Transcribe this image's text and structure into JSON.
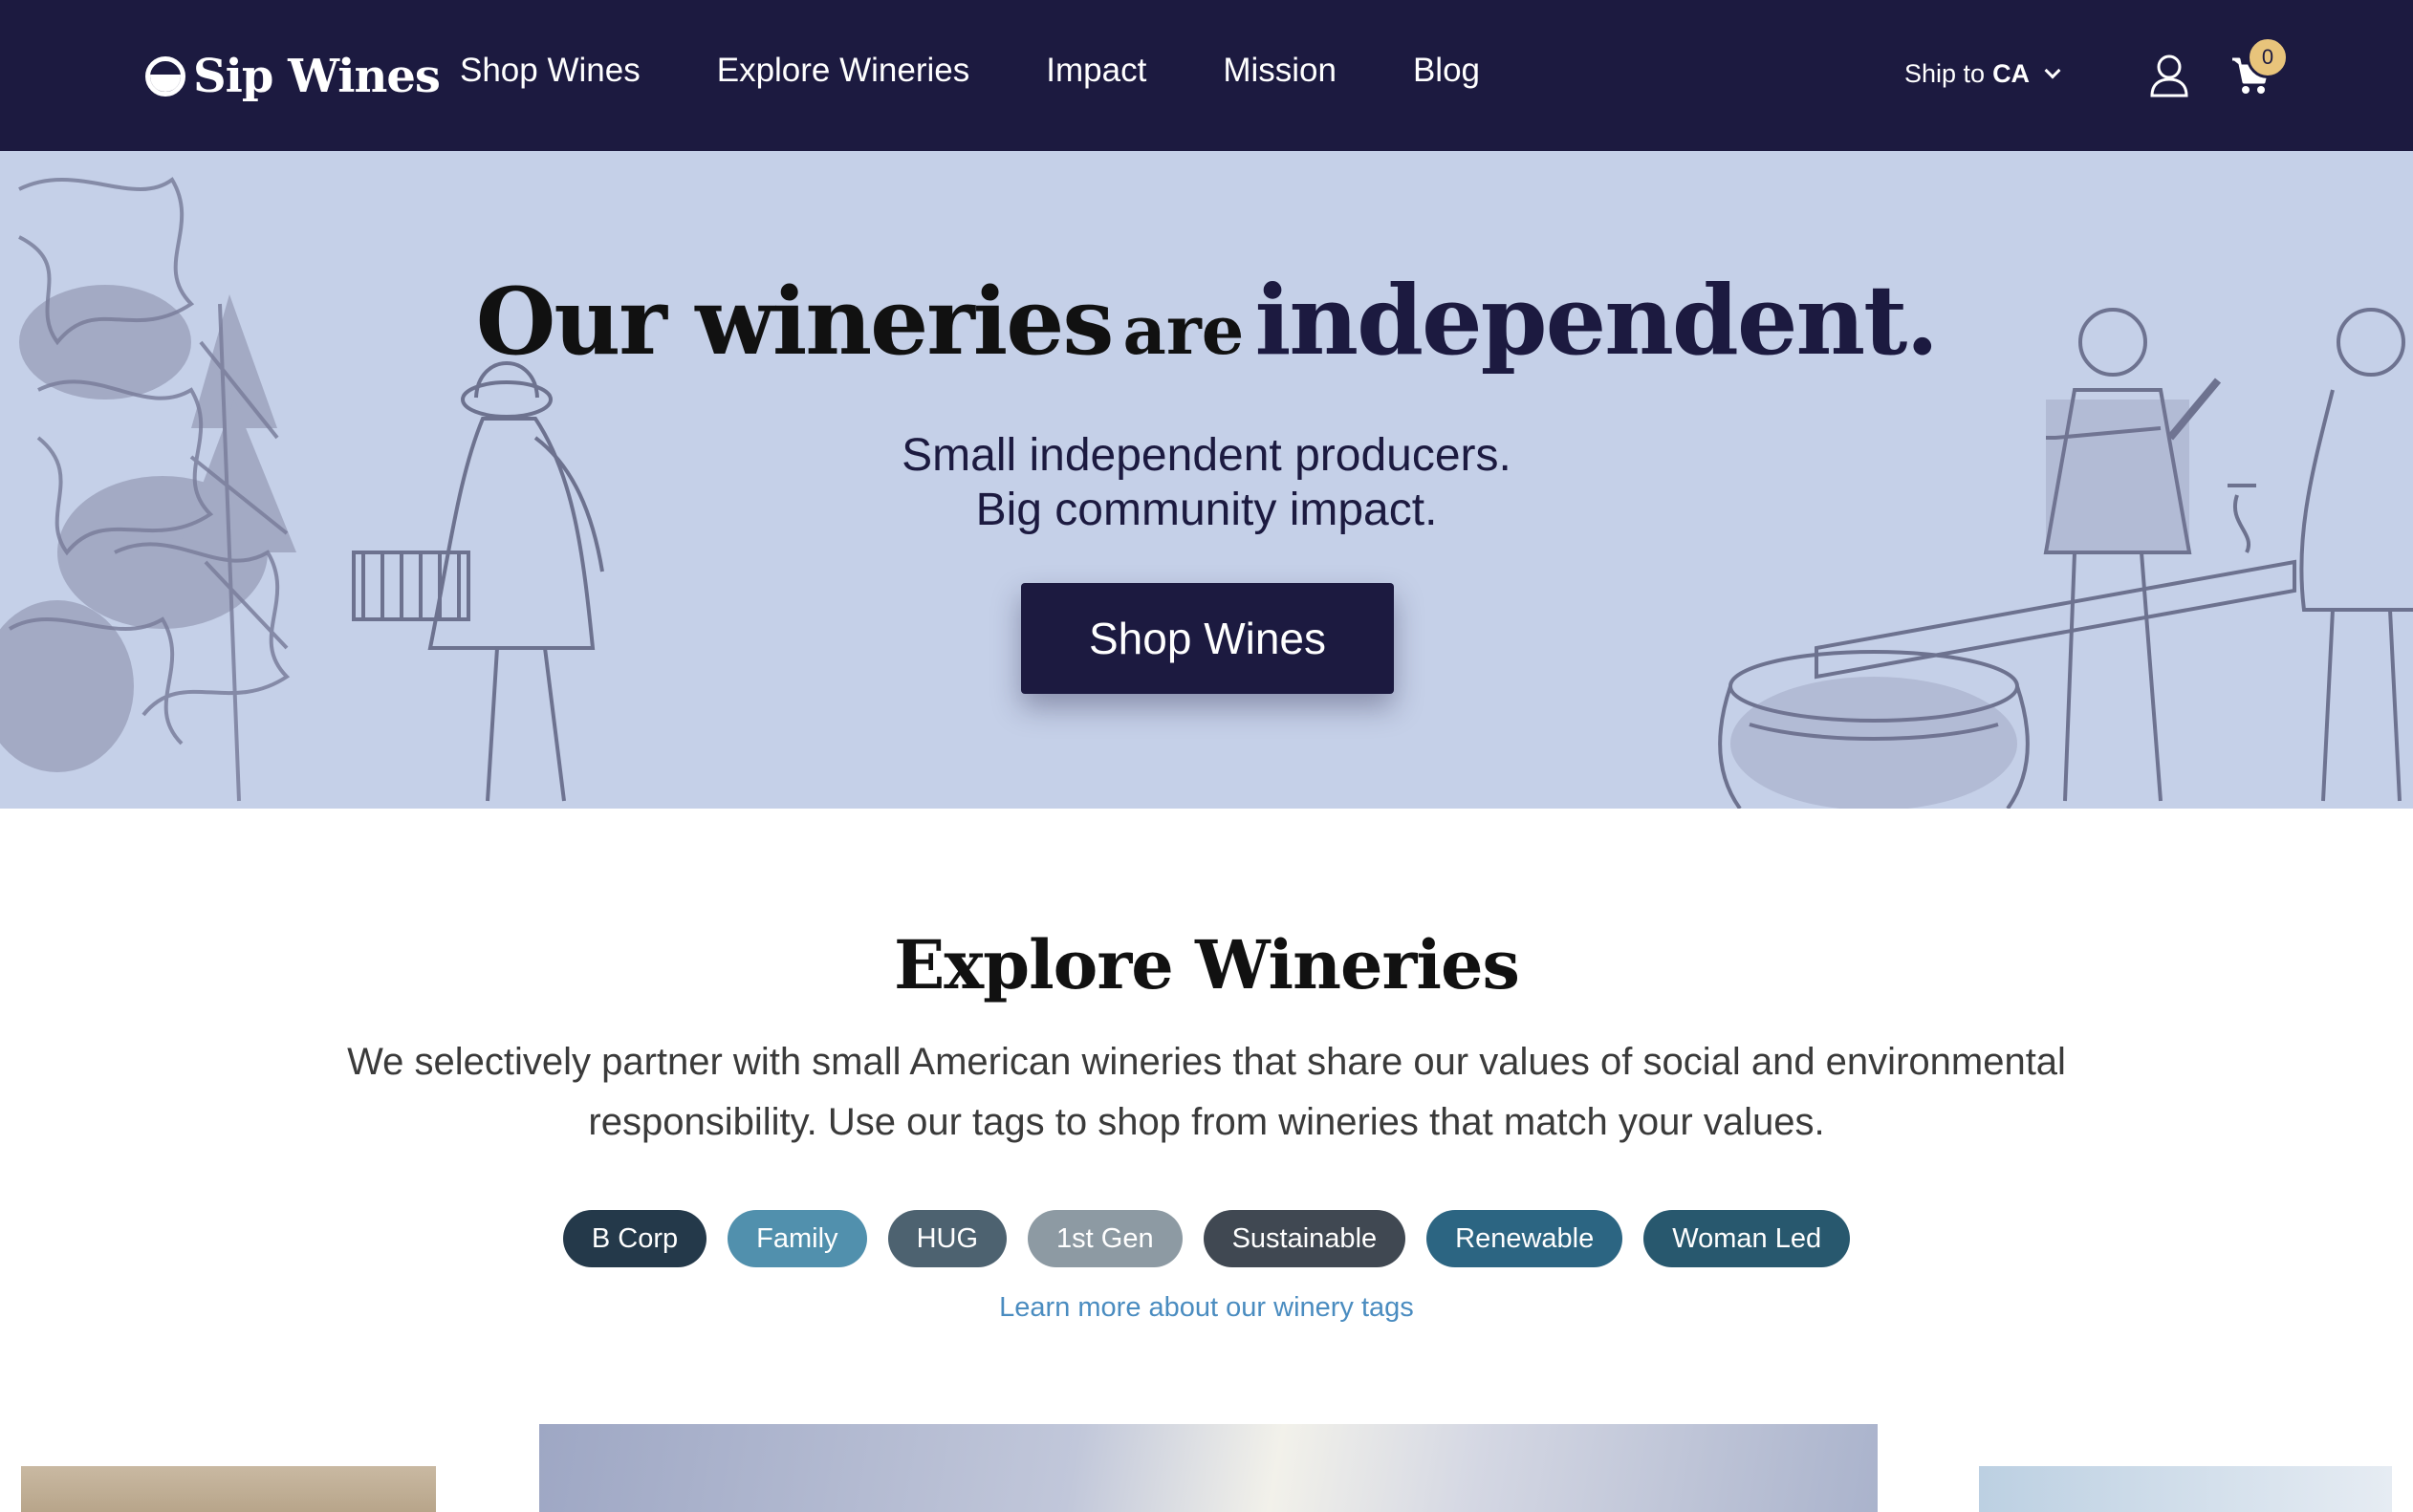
{
  "nav": {
    "logo": "Sip Wines",
    "links": [
      "Shop Wines",
      "Explore Wineries",
      "Impact",
      "Mission",
      "Blog"
    ],
    "ship_label": "Ship to",
    "ship_region": "CA",
    "cart_count": "0",
    "icons": [
      "user-icon",
      "cart-icon",
      "chevron-down-icon"
    ]
  },
  "hero": {
    "title_part1": "Our wineries",
    "title_part2": "are",
    "title_part3": "independent.",
    "subtitle_line1": "Small independent producers.",
    "subtitle_line2": "Big community impact.",
    "cta": "Shop Wines",
    "background_color": "#c5d0e8"
  },
  "explore": {
    "title": "Explore Wineries",
    "description": "We selectively partner with small American wineries that share our values of social and environmental responsibility. Use our tags to shop from wineries that match your values.",
    "tags": [
      {
        "label": "B Corp",
        "color": "#24394a"
      },
      {
        "label": "Family",
        "color": "#5190ad"
      },
      {
        "label": "HUG",
        "color": "#4d6270"
      },
      {
        "label": "1st Gen",
        "color": "#8d9aa3"
      },
      {
        "label": "Sustainable",
        "color": "#404852"
      },
      {
        "label": "Renewable",
        "color": "#2c6582"
      },
      {
        "label": "Woman Led",
        "color": "#28586e"
      }
    ],
    "learn_more": "Learn more about our winery tags"
  },
  "colors": {
    "nav_bg": "#1c1a40",
    "accent": "#1c1a40",
    "badge": "#e8c47b",
    "link": "#4a8cc0"
  }
}
